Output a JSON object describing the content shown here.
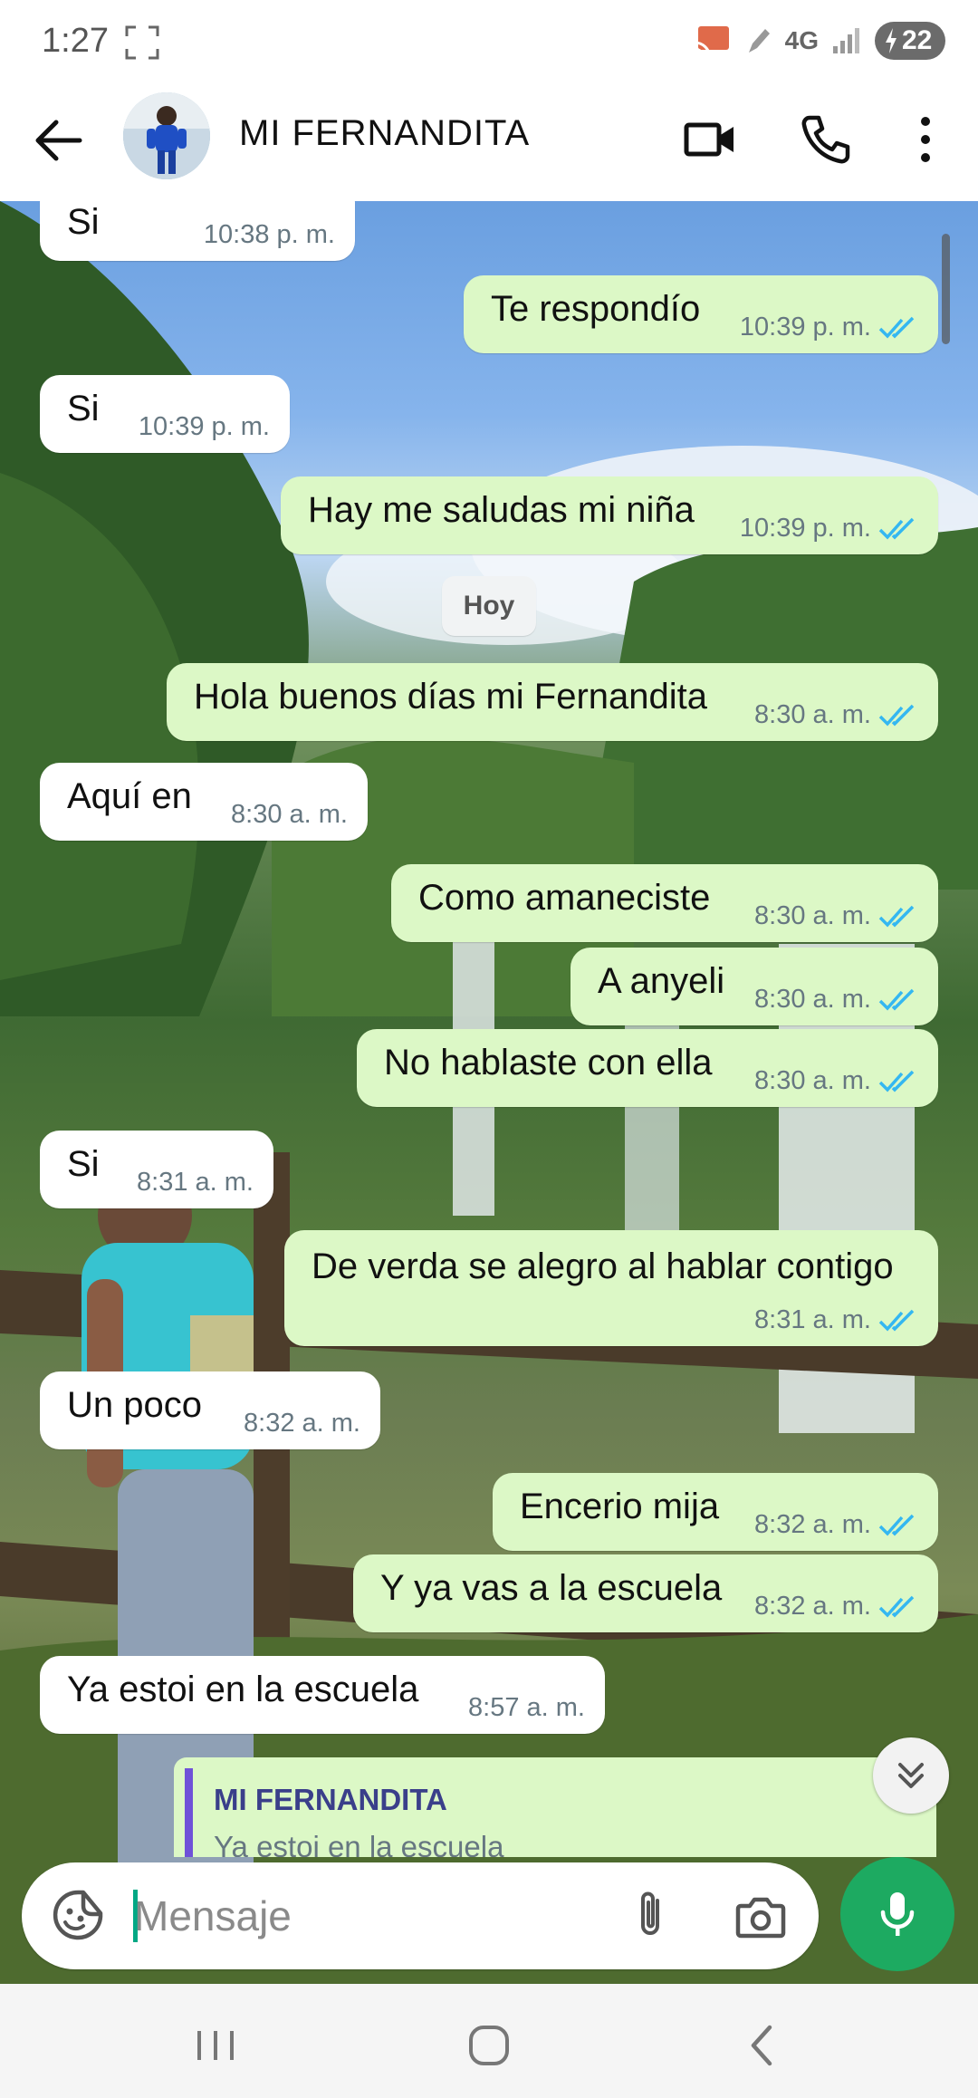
{
  "status_bar": {
    "time": "1:27",
    "network": "4G",
    "battery": "22"
  },
  "header": {
    "contact_name": "MI FERNANDITA"
  },
  "messages": [
    {
      "text": "Si",
      "time": "10:38 p. m."
    },
    {
      "text": "Te respondío",
      "time": "10:39 p. m."
    },
    {
      "text": "Si",
      "time": "10:39 p. m."
    },
    {
      "text": "Hay me saludas mi niña",
      "time": "10:39 p. m."
    },
    {
      "text": "Hola buenos días mi Fernandita",
      "time": "8:30 a. m."
    },
    {
      "text": "Aquí en",
      "time": "8:30 a. m."
    },
    {
      "text": "Como amaneciste",
      "time": "8:30 a. m."
    },
    {
      "text": "A anyeli",
      "time": "8:30 a. m."
    },
    {
      "text": "No hablaste con ella",
      "time": "8:30 a. m."
    },
    {
      "text": "Si",
      "time": "8:31 a. m."
    },
    {
      "text": "De verda se alegro al hablar contigo",
      "time": "8:31 a. m."
    },
    {
      "text": "Un poco",
      "time": "8:32 a. m."
    },
    {
      "text": "Encerio mija",
      "time": "8:32 a. m."
    },
    {
      "text": "Y ya vas a la escuela",
      "time": "8:32 a. m."
    },
    {
      "text": "Ya estoi en la escuela",
      "time": "8:57 a. m."
    }
  ],
  "day_separator": "Hoy",
  "reply_preview": {
    "name": "MI FERNANDITA",
    "text": "Ya estoi en la escuela"
  },
  "composer": {
    "placeholder": "Mensaje"
  },
  "colors": {
    "outgoing_bubble": "#dcf8c6",
    "incoming_bubble": "#ffffff",
    "read_ticks": "#34b7f1",
    "mic_button": "#1daa61"
  }
}
